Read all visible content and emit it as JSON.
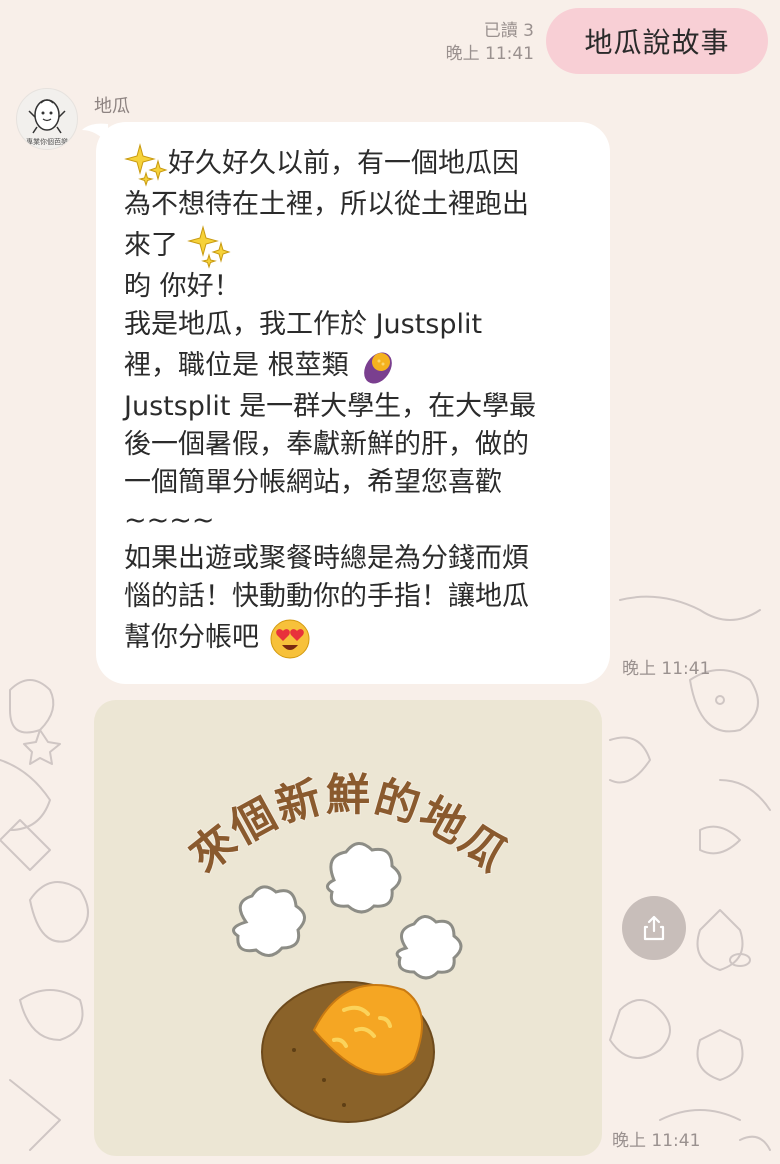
{
  "sent_message": {
    "text": "地瓜說故事",
    "read_status": "已讀 3",
    "time": "晚上 11:41"
  },
  "sender": {
    "name": "地瓜",
    "avatar_caption": "專業你個芭樂"
  },
  "received_message": {
    "lines": [
      "好久好久以前，有一個地瓜因",
      "為不想待在土裡，所以從土裡跑出",
      "來了",
      "昀 你好！",
      "我是地瓜，我工作於 Justsplit",
      "裡，職位是 根莖類",
      "Justsplit 是一群大學生，在大學最",
      "後一個暑假，奉獻新鮮的肝，做的",
      "一個簡單分帳網站，希望您喜歡",
      "~~~~",
      "如果出遊或聚餐時總是為分錢而煩",
      "惱的話！快動動你的手指！讓地瓜",
      "幫你分帳吧"
    ],
    "time": "晚上 11:41",
    "emoji": [
      "sparkles-icon",
      "sweet-potato-icon",
      "heart-eyes-icon"
    ]
  },
  "sticker": {
    "title": "來個新鮮的地瓜",
    "time": "晚上 11:41"
  },
  "share_button": {
    "icon": "share-icon"
  },
  "colors": {
    "background": "#f8efe9",
    "sent_bubble": "#f8cfd5",
    "received_bubble": "#ffffff",
    "sticker_background": "#ece6d4",
    "sticker_title": "#8a5a2e"
  }
}
